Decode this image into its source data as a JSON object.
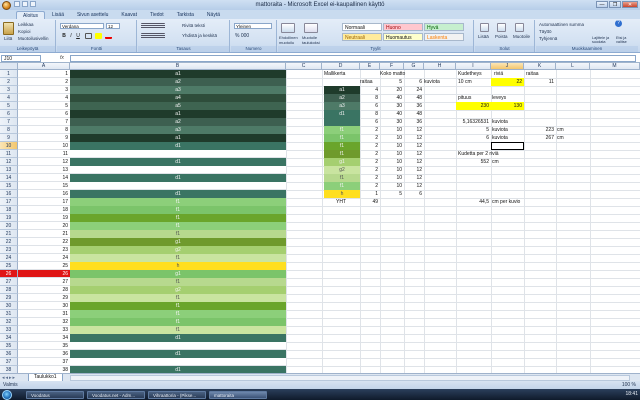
{
  "window": {
    "title": "mattoraita - Microsoft Excel ei-kaupallinen käyttö",
    "controls": [
      "—",
      "❐",
      "✕"
    ]
  },
  "ribbon": {
    "tabs": [
      "Aloitus",
      "Lisää",
      "Sivun asettelu",
      "Kaavat",
      "Tiedot",
      "Tarkista",
      "Näytä"
    ],
    "active_tab": "Aloitus",
    "clipboard": {
      "paste": "Liitä",
      "cut": "Leikkaa",
      "copy": "Kopioi",
      "format_painter": "Muotoilusivellin",
      "label": "Leikepöytä"
    },
    "font": {
      "name": "Verdana",
      "size": "12",
      "bold": "B",
      "italic": "I",
      "underline": "U",
      "label": "Fontti"
    },
    "alignment": {
      "wrap": "Rivitä teksti",
      "merge": "Yhdistä ja keskitä",
      "label": "Tasaus"
    },
    "number": {
      "format": "Yleinen",
      "label": "Numero"
    },
    "styles": {
      "conditional": "Ehdollinen muotoilu",
      "format_table": "Muotoile taulukoksi",
      "cells": [
        "Normaali",
        "Huono",
        "Hyvä",
        "Neutraali",
        "Huomautus",
        "Laskenta"
      ],
      "cell_colors": [
        "#ffffff",
        "#ffc7ce",
        "#c6efce",
        "#ffeb9c",
        "#ffffcc",
        "#f2f2f2"
      ],
      "cell_text_colors": [
        "#111111",
        "#9c0006",
        "#006100",
        "#9c6500",
        "#111111",
        "#fa7d00"
      ],
      "label": "Tyylit"
    },
    "cells_group": {
      "insert": "Lisää",
      "delete": "Poista",
      "format": "Muotoile",
      "label": "Solut"
    },
    "editing": {
      "autosum": "Automaattinen summa",
      "fill": "Täyttö",
      "clear": "Tyhjennä",
      "sort": "Lajittele ja suodata",
      "find": "Etsi ja valitse",
      "label": "Muokkaaminen"
    }
  },
  "formula_bar": {
    "name_box": "J10",
    "fx": "fx",
    "value": ""
  },
  "columns": [
    "A",
    "B",
    "C",
    "D",
    "E",
    "F",
    "G",
    "H",
    "I",
    "J",
    "K",
    "L",
    "M"
  ],
  "selected_column": "J",
  "row_count": 38,
  "selected_row": 10,
  "col_a_values": [
    "1",
    "2",
    "3",
    "4",
    "5",
    "6",
    "7",
    "8",
    "9",
    "10",
    "11",
    "12",
    "13",
    "14",
    "15",
    "16",
    "17",
    "18",
    "19",
    "20",
    "21",
    "22",
    "23",
    "24",
    "25",
    "26",
    "27",
    "28",
    "29",
    "30",
    "31",
    "32",
    "33",
    "34",
    "35",
    "36",
    "37",
    "38"
  ],
  "col_a_red_row": 26,
  "col_b_pattern": [
    {
      "label": "a1",
      "color": "#1f3b2b"
    },
    {
      "label": "a2",
      "color": "#3d5f50"
    },
    {
      "label": "a3",
      "color": "#4e7a67"
    },
    {
      "label": "a4",
      "color": "#2e4d3b"
    },
    {
      "label": "a5",
      "color": "#3e6451"
    },
    {
      "label": "a1",
      "color": "#1f3b2b"
    },
    {
      "label": "a2",
      "color": "#3d5f50"
    },
    {
      "label": "a3",
      "color": "#4e7a67"
    },
    {
      "label": "a1",
      "color": "#1f3b2b"
    },
    {
      "label": "d1",
      "color": "#3a7463"
    },
    {
      "label": "",
      "color": "#ffffff"
    },
    {
      "label": "d1",
      "color": "#3a7463"
    },
    {
      "label": "",
      "color": "#ffffff"
    },
    {
      "label": "d1",
      "color": "#3a7463"
    },
    {
      "label": "",
      "color": "#ffffff"
    },
    {
      "label": "d1",
      "color": "#3a7463"
    },
    {
      "label": "f1",
      "color": "#8ccf7a"
    },
    {
      "label": "f1",
      "color": "#7bc46a"
    },
    {
      "label": "f1",
      "color": "#6aa52b"
    },
    {
      "label": "f1",
      "color": "#8ccf7a"
    },
    {
      "label": "f1",
      "color": "#b7d98e"
    },
    {
      "label": "g1",
      "color": "#6f9a2c"
    },
    {
      "label": "g2",
      "color": "#a5cf70"
    },
    {
      "label": "f1",
      "color": "#c9e4a0"
    },
    {
      "label": "h",
      "color": "#ffdf1f"
    },
    {
      "label": "g1",
      "color": "#7bc46a"
    },
    {
      "label": "f1",
      "color": "#b7d98e"
    },
    {
      "label": "g2",
      "color": "#a5cf70"
    },
    {
      "label": "f1",
      "color": "#c9e4a0"
    },
    {
      "label": "f1",
      "color": "#6aa52b"
    },
    {
      "label": "f1",
      "color": "#8ccf7a"
    },
    {
      "label": "f1",
      "color": "#7bc46a"
    },
    {
      "label": "f1",
      "color": "#c9e4a0"
    },
    {
      "label": "d1",
      "color": "#3a7463"
    },
    {
      "label": "",
      "color": "#ffffff"
    },
    {
      "label": "d1",
      "color": "#3a7463"
    },
    {
      "label": "",
      "color": "#ffffff"
    },
    {
      "label": "d1",
      "color": "#3a7463"
    }
  ],
  "table": {
    "mallikerta": "Mallikerta",
    "koko_matto": "Koko matto",
    "raitaa_header": "raitaa",
    "five": "5",
    "six": "6",
    "kuviota": "kuviota",
    "rows": [
      {
        "swatch": "a1",
        "color": "#1f3b2b",
        "e": "4",
        "f": "20",
        "g": "24"
      },
      {
        "swatch": "a2",
        "color": "#3d5f50",
        "e": "8",
        "f": "40",
        "g": "48"
      },
      {
        "swatch": "a3",
        "color": "#4e7a67",
        "e": "6",
        "f": "30",
        "g": "36"
      },
      {
        "swatch": "d1",
        "color": "#3a7463",
        "e": "8",
        "f": "40",
        "g": "48"
      },
      {
        "swatch": "",
        "color": "#3a7463",
        "e": "6",
        "f": "30",
        "g": "36"
      },
      {
        "swatch": "f1",
        "color": "#8ccf7a",
        "e": "2",
        "f": "10",
        "g": "12"
      },
      {
        "swatch": "f1",
        "color": "#7bc46a",
        "e": "2",
        "f": "10",
        "g": "12"
      },
      {
        "swatch": "f1",
        "color": "#6aa52b",
        "e": "2",
        "f": "10",
        "g": "12"
      },
      {
        "swatch": "f1",
        "color": "#6f9a2c",
        "e": "2",
        "f": "10",
        "g": "12"
      },
      {
        "swatch": "g1",
        "color": "#a5cf70",
        "e": "2",
        "f": "10",
        "g": "12"
      },
      {
        "swatch": "g2",
        "color": "#c9e4a0",
        "e": "2",
        "f": "10",
        "g": "12"
      },
      {
        "swatch": "f1",
        "color": "#b7d98e",
        "e": "2",
        "f": "10",
        "g": "12"
      },
      {
        "swatch": "f1",
        "color": "#8ccf7a",
        "e": "2",
        "f": "10",
        "g": "12"
      },
      {
        "swatch": "h",
        "color": "#ffdf1f",
        "e": "1",
        "f": "5",
        "g": "6"
      }
    ],
    "yht": "YHT",
    "yht_value": "49"
  },
  "calc": {
    "kudetheys": "Kudetheys",
    "rivia": "riviä",
    "raitaa": "raitaa",
    "ten_cm": "10 cm",
    "rivia_value": "22",
    "raitaa_value": "11",
    "pituus": "pituus",
    "leveys": "leveys",
    "pituus_value": "230",
    "leveys_value": "130",
    "kuviota_calc": "5,16326531",
    "kuviota_word": "kuviota",
    "five_kuviota": "5",
    "six_kuviota": "6",
    "cm_223": "223",
    "cm_267": "267",
    "cm": "cm",
    "kudetta_label": "Kudetta per 2 riviä",
    "kudetta_value": "552",
    "per_kuvio_value": "44,5",
    "per_kuvio_label": "cm per kuvio",
    "highlight": "#ffff00"
  },
  "sheet_tab": "Taulukko1",
  "status": {
    "text": "Valmis",
    "zoom": "100 %"
  },
  "taskbar": {
    "tasks": [
      "Voodatus",
      "Voodatus.net - Adm...",
      "Vihraattoria - (Pikse...",
      "mattoraita"
    ],
    "active_index": 3,
    "clock": "18:41"
  }
}
